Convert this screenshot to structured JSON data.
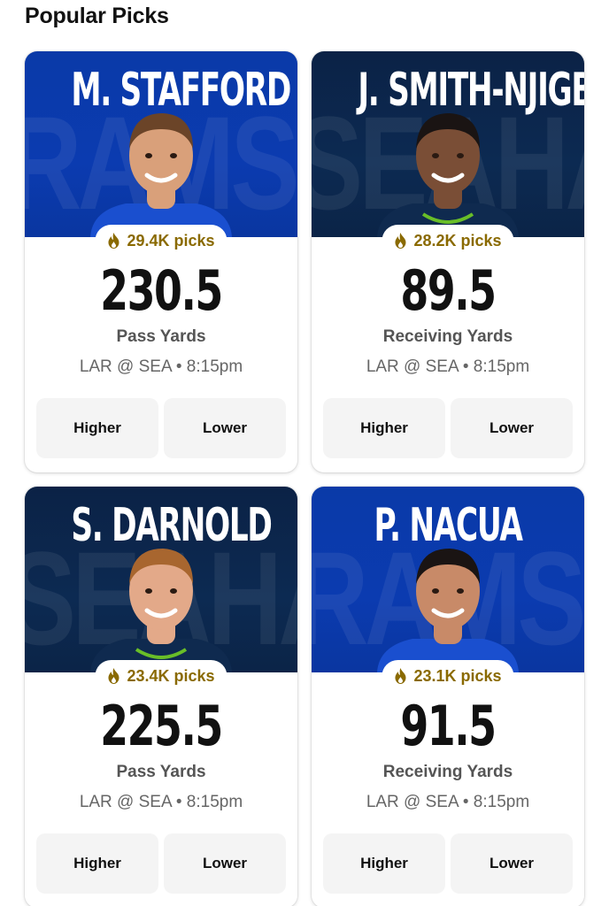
{
  "section": {
    "title": "Popular Picks"
  },
  "cards": [
    {
      "player": "M. STAFFORD",
      "team_watermark": "RAMS",
      "team_theme": "rams",
      "jersey_color": "#1a4fcf",
      "picks": "29.4K picks",
      "line": "230.5",
      "stat": "Pass Yards",
      "matchup": "LAR @ SEA • 8:15pm",
      "higher_label": "Higher",
      "lower_label": "Lower"
    },
    {
      "player": "J. SMITH-NJIGBA",
      "team_watermark": "SEAHAWKS",
      "team_theme": "sea",
      "jersey_color": "#0f2a4f",
      "picks": "28.2K picks",
      "line": "89.5",
      "stat": "Receiving Yards",
      "matchup": "LAR @ SEA • 8:15pm",
      "higher_label": "Higher",
      "lower_label": "Lower"
    },
    {
      "player": "S. DARNOLD",
      "team_watermark": "SEAHAWKS",
      "team_theme": "sea",
      "jersey_color": "#0f2a4f",
      "picks": "23.4K picks",
      "line": "225.5",
      "stat": "Pass Yards",
      "matchup": "LAR @ SEA • 8:15pm",
      "higher_label": "Higher",
      "lower_label": "Lower"
    },
    {
      "player": "P. NACUA",
      "team_watermark": "RAMS",
      "team_theme": "rams",
      "jersey_color": "#1a4fcf",
      "picks": "23.1K picks",
      "line": "91.5",
      "stat": "Receiving Yards",
      "matchup": "LAR @ SEA • 8:15pm",
      "higher_label": "Higher",
      "lower_label": "Lower"
    }
  ],
  "colors": {
    "rams_blue": "#0a3aa8",
    "seahawks_navy": "#0b2246",
    "picks_gold": "#8a6a00",
    "seahawks_green": "#69be28"
  },
  "icons": {
    "picks": "flame-icon"
  }
}
